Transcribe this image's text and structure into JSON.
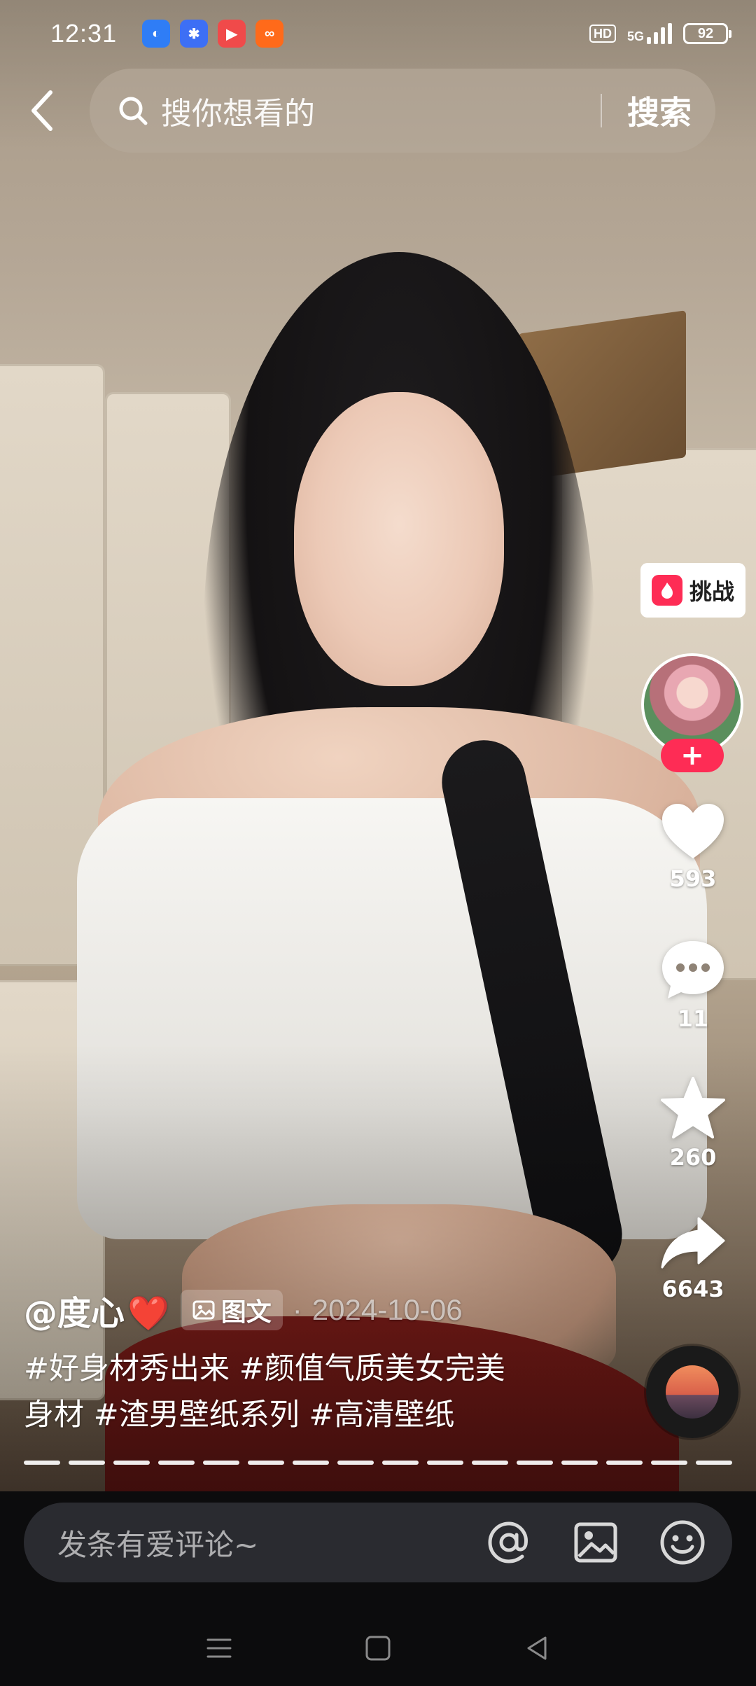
{
  "status_bar": {
    "time": "12:31",
    "notifications": [
      {
        "icon": "browser-app-icon",
        "color": "#2f7df6",
        "glyph": "◐"
      },
      {
        "icon": "baidu-app-icon",
        "color": "#3d6ff5",
        "glyph": "✱"
      },
      {
        "icon": "video-app-icon",
        "color": "#f04a4a",
        "glyph": "▶"
      },
      {
        "icon": "kuaishou-app-icon",
        "color": "#ff6a1a",
        "glyph": "∞"
      }
    ],
    "hd_label": "HD",
    "network_label": "5G",
    "battery": "92"
  },
  "search": {
    "placeholder": "搜你想看的",
    "submit_label": "搜索"
  },
  "actions": {
    "challenge_label": "挑战",
    "like_count": "593",
    "comment_count": "11",
    "favorite_count": "260",
    "share_count": "6643"
  },
  "post": {
    "author": "@度心",
    "author_emoji": "❤️",
    "type_label": "图文",
    "date_separator": "·",
    "date": "2024-10-06",
    "caption_line1": "#好身材秀出来 #颜值气质美女完美",
    "caption_line2": "身材 #渣男壁纸系列 #高清壁纸",
    "image_count": 16
  },
  "comment_bar": {
    "placeholder": "发条有爱评论~"
  },
  "colors": {
    "accent": "#fe2c55",
    "comment_bar_bg": "#2a2b30"
  }
}
